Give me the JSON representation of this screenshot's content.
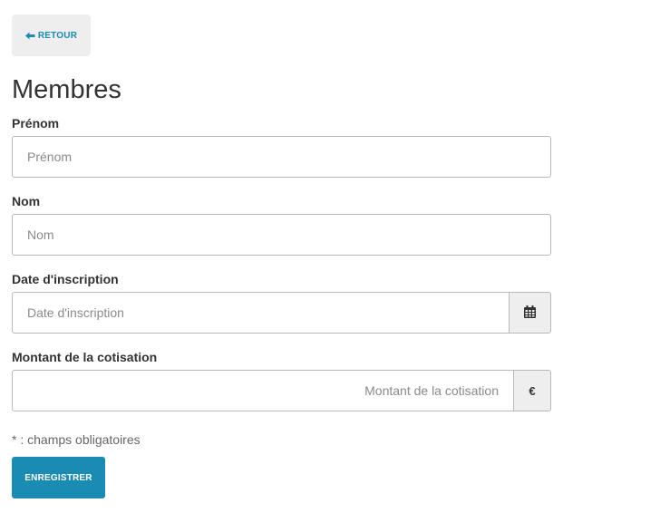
{
  "navigation": {
    "back_label": "RETOUR"
  },
  "page": {
    "title": "Membres"
  },
  "form": {
    "first_name": {
      "label": "Prénom",
      "placeholder": "Prénom",
      "value": ""
    },
    "last_name": {
      "label": "Nom",
      "placeholder": "Nom",
      "value": ""
    },
    "registration_date": {
      "label": "Date d'inscription",
      "placeholder": "Date d'inscription",
      "value": "",
      "addon_icon": "calendar-icon"
    },
    "membership_fee": {
      "label": "Montant de la cotisation",
      "placeholder": "Montant de la cotisation",
      "value": "",
      "addon_symbol": "€"
    },
    "required_note": "* : champs obligatoires",
    "submit_label": "ENREGISTRER"
  },
  "colors": {
    "accent": "#1a8bb3",
    "button_background": "#eeeeee",
    "text": "#333333",
    "border": "#b9b9b9"
  },
  "icons": {
    "back": "arrow-left-icon",
    "calendar": "calendar-icon"
  }
}
